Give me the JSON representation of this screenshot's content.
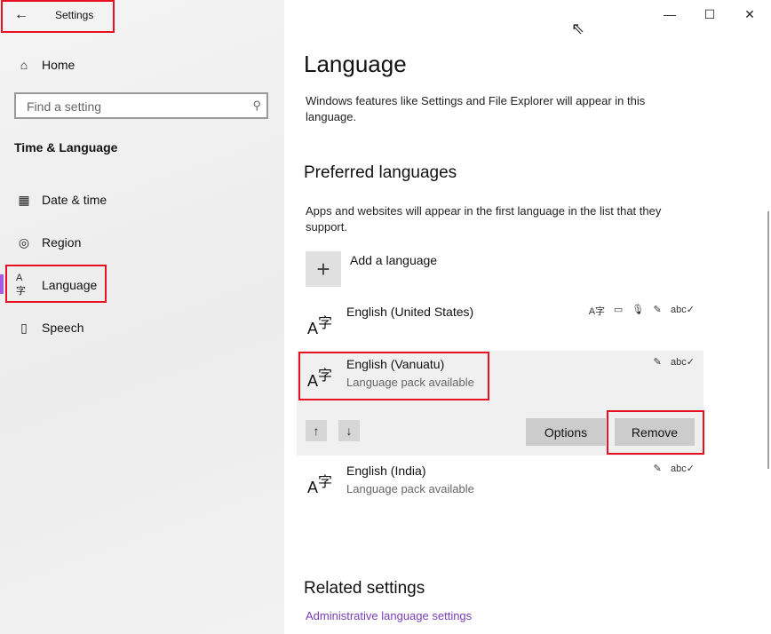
{
  "window": {
    "title": "Settings",
    "back_icon": "←",
    "minimize_icon": "—",
    "maximize_icon": "☐",
    "close_icon": "✕",
    "cursor_icon": "⇖"
  },
  "sidebar": {
    "home_icon": "⌂",
    "home_label": "Home",
    "search_placeholder": "Find a setting",
    "search_icon": "⚲",
    "section_title": "Time & Language",
    "items": [
      {
        "icon": "▦",
        "label": "Date & time"
      },
      {
        "icon": "◎",
        "label": "Region"
      },
      {
        "icon": "A字",
        "label": "Language"
      },
      {
        "icon": "▯",
        "label": "Speech"
      }
    ],
    "selected_color": "#8a2be2"
  },
  "main": {
    "title": "Language",
    "description": "Windows features like Settings and File Explorer will appear in this language.",
    "preferred_title": "Preferred languages",
    "preferred_desc": "Apps and websites will appear in the first language in the list that they support.",
    "add_icon": "+",
    "add_label": "Add a language",
    "languages": [
      {
        "name": "English (United States)",
        "sub": "",
        "features": [
          "A字",
          "▭",
          "🎙",
          "✎",
          "abc✓"
        ]
      },
      {
        "name": "English (Vanuatu)",
        "sub": "Language pack available",
        "features": [
          "✎",
          "abc✓"
        ]
      },
      {
        "name": "English (India)",
        "sub": "Language pack available",
        "features": [
          "✎",
          "abc✓"
        ]
      }
    ],
    "up_icon": "↑",
    "down_icon": "↓",
    "options_label": "Options",
    "remove_label": "Remove",
    "related_title": "Related settings",
    "admin_link": "Administrative language settings",
    "link_color": "#7a3db8",
    "highlight_color": "#e81123"
  }
}
